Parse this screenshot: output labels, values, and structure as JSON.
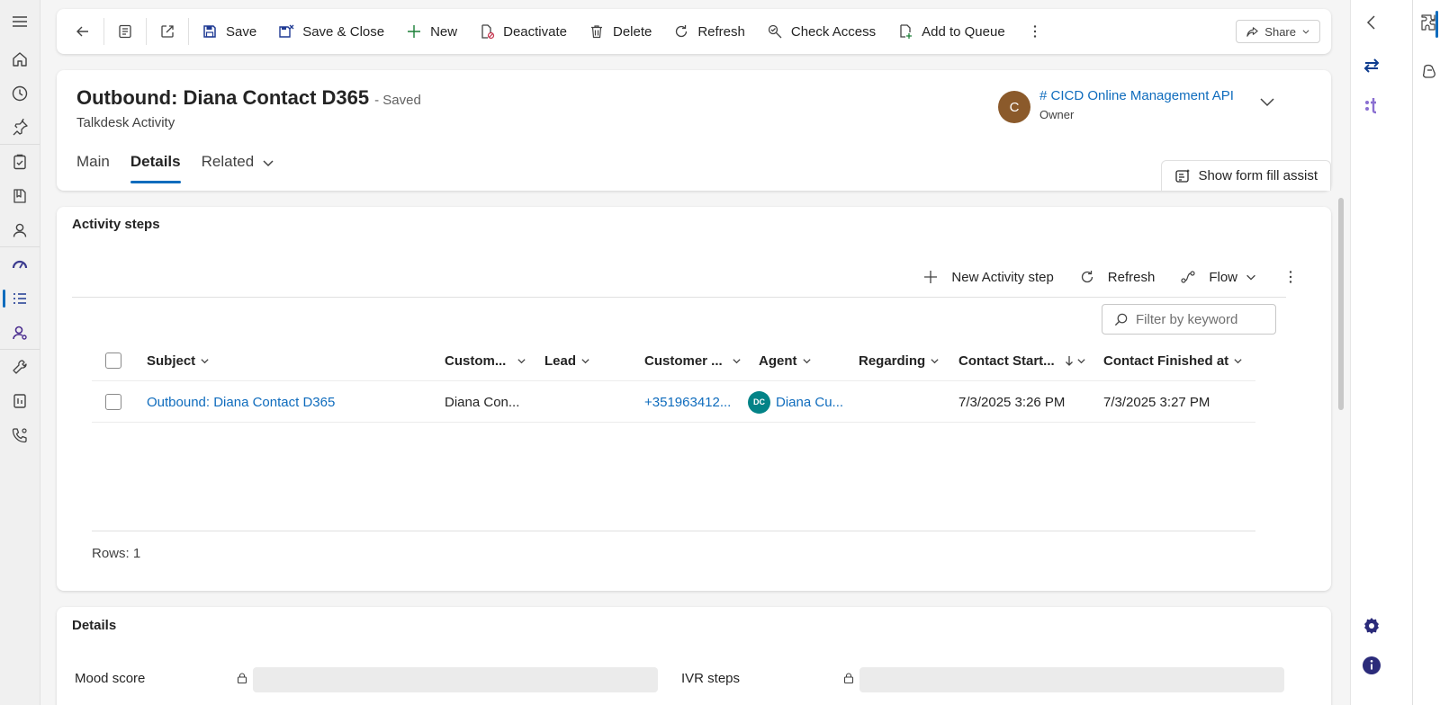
{
  "leftnav": {
    "items": [
      "hamburger-icon",
      "home-icon",
      "recent-icon",
      "pinned-icon",
      "clipboard-icon",
      "book-icon",
      "person-icon",
      "dashboard-icon",
      "activity-list-icon",
      "agent-icon",
      "wrench-icon",
      "report-icon",
      "phone-settings-icon"
    ],
    "active_index": 8,
    "accent_color": "#0f6cbd"
  },
  "toolbar": {
    "save": "Save",
    "save_close": "Save & Close",
    "new": "New",
    "deactivate": "Deactivate",
    "delete": "Delete",
    "refresh": "Refresh",
    "check_access": "Check Access",
    "add_to_queue": "Add to Queue",
    "share": "Share"
  },
  "header": {
    "title": "Outbound: Diana Contact D365",
    "saved_status": "- Saved",
    "entity": "Talkdesk Activity",
    "owner_initial": "C",
    "owner_name": "# CICD Online Management API",
    "owner_label": "Owner",
    "owner_avatar_color": "#8b5a2b",
    "form_fill": "Show form fill assist"
  },
  "tabs": {
    "main": "Main",
    "details": "Details",
    "related": "Related"
  },
  "activity_steps": {
    "title": "Activity steps",
    "new_step": "New Activity step",
    "refresh": "Refresh",
    "flow": "Flow",
    "filter_placeholder": "Filter by keyword",
    "columns": {
      "subject": "Subject",
      "customer": "Custom...",
      "lead": "Lead",
      "customer_phone": "Customer ...",
      "agent": "Agent",
      "regarding": "Regarding",
      "contact_started": "Contact Start...",
      "contact_finished": "Contact Finished at"
    },
    "rows": [
      {
        "subject": "Outbound: Diana Contact D365",
        "customer": "Diana Con...",
        "lead": "",
        "customer_phone": "+351963412...",
        "agent_initials": "DC",
        "agent": "Diana Cu...",
        "regarding": "",
        "contact_started": "7/3/2025 3:26 PM",
        "contact_finished": "7/3/2025 3:27 PM"
      }
    ],
    "rows_count": "Rows: 1"
  },
  "details": {
    "title": "Details",
    "mood_score": "Mood score",
    "ivr_steps": "IVR steps"
  },
  "rightpane": {
    "icons": [
      "collapse-chevron-icon",
      "swap-arrows-icon",
      "talkdesk-logo-icon",
      "settings-gear-icon",
      "info-icon"
    ]
  }
}
